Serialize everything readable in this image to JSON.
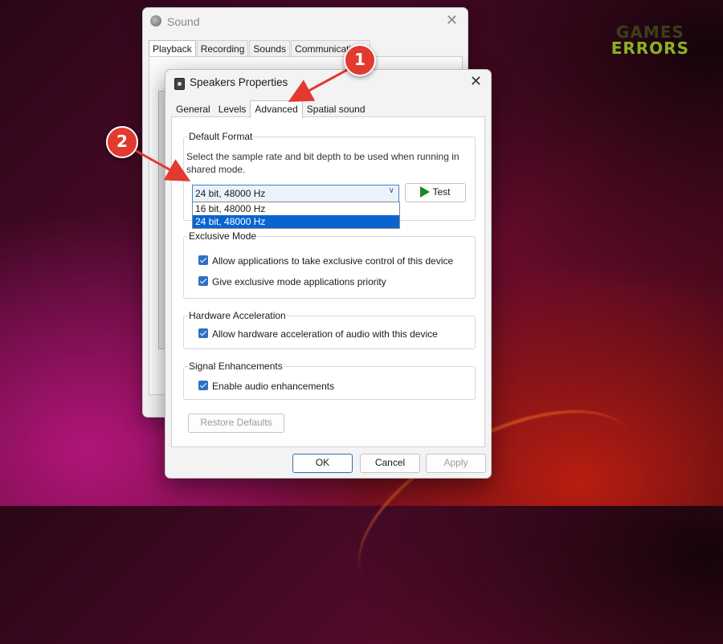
{
  "brand": {
    "line1": "GAMES",
    "line2": "ERRORS"
  },
  "sound_window": {
    "title": "Sound",
    "close_glyph": "✕",
    "tabs": [
      "Playback",
      "Recording",
      "Sounds",
      "Communications"
    ],
    "active_tab": "Playback"
  },
  "dialog": {
    "title": "Speakers Properties",
    "close_glyph": "✕",
    "tabs": [
      "General",
      "Levels",
      "Advanced",
      "Spatial sound"
    ],
    "active_tab": "Advanced",
    "default_format": {
      "label": "Default Format",
      "description": "Select the sample rate and bit depth to be used when running in shared mode.",
      "selected": "24 bit, 48000 Hz",
      "options": [
        "16 bit, 48000 Hz",
        "24 bit, 48000 Hz"
      ],
      "test_label": "Test"
    },
    "exclusive_mode": {
      "label": "Exclusive Mode",
      "items": [
        {
          "label": "Allow applications to take exclusive control of this device",
          "checked": true
        },
        {
          "label": "Give exclusive mode applications priority",
          "checked": true
        }
      ]
    },
    "hardware_acceleration": {
      "label": "Hardware Acceleration",
      "item": {
        "label": "Allow hardware acceleration of audio with this device",
        "checked": true
      }
    },
    "signal_enhancements": {
      "label": "Signal Enhancements",
      "item": {
        "label": "Enable audio enhancements",
        "checked": true
      }
    },
    "restore_defaults": "Restore Defaults",
    "ok": "OK",
    "cancel": "Cancel",
    "apply": "Apply"
  },
  "annotations": [
    "1",
    "2"
  ],
  "colors": {
    "accent": "#2f6fc5",
    "selection": "#0a64d0",
    "marker": "#e23a2f"
  }
}
